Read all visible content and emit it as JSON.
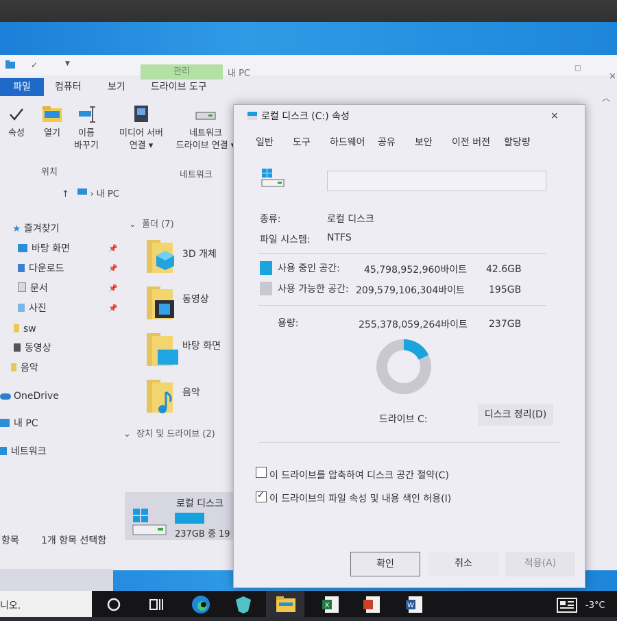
{
  "explorer": {
    "title": "내 PC",
    "ribbon_context": "관리",
    "tabs": [
      "파일",
      "컴퓨터",
      "보기",
      "드라이브 도구"
    ],
    "ribbon_buttons": {
      "properties": "속성",
      "open": "열기",
      "rename_1": "이름",
      "rename_2": "바꾸기",
      "media_1": "미디어 서버",
      "media_2": "연결 ▾",
      "netdrive_1": "네트워크",
      "netdrive_2": "드라이브 연결 ▾"
    },
    "ribbon_groups": {
      "location": "위치",
      "network": "네트워크"
    },
    "address": "내 PC",
    "nav": {
      "quick_access": "즐겨찾기",
      "desktop": "바탕 화면",
      "downloads": "다운로드",
      "documents": "문서",
      "pictures": "사진",
      "sw": "sw",
      "videos": "동영상",
      "music": "음악",
      "onedrive": "OneDrive",
      "this_pc": "내 PC",
      "network": "네트워크"
    },
    "folders_header": "폴더 (7)",
    "folders": [
      "3D 개체",
      "동영상",
      "바탕 화면",
      "음악"
    ],
    "devices_header": "장치 및 드라이브 (2)",
    "drive": {
      "name": "로컬 디스크",
      "size_text": "237GB 중 19",
      "used_fraction": 0.18
    },
    "status": {
      "items": "항목",
      "selected": "1개 항목 선택함"
    }
  },
  "dialog": {
    "title": "로컬 디스크 (C:) 속성",
    "close": "×",
    "tabs": [
      "일반",
      "도구",
      "하드웨어",
      "공유",
      "보안",
      "이전 버전",
      "할당량"
    ],
    "type_label": "종류:",
    "type_value": "로컬 디스크",
    "fs_label": "파일 시스템:",
    "fs_value": "NTFS",
    "used_label": "사용 중인 공간:",
    "used_bytes": "45,798,952,960바이트",
    "used_gb": "42.6GB",
    "free_label": "사용 가능한 공간:",
    "free_bytes": "209,579,106,304바이트",
    "free_gb": "195GB",
    "capacity_label": "용량:",
    "capacity_bytes": "255,378,059,264바이트",
    "capacity_gb": "237GB",
    "drive_label": "드라이브 C:",
    "cleanup_button": "디스크 정리(D)",
    "compress_checkbox": "이 드라이브를 압축하여 디스크 공간 절약(C)",
    "compress_checked": false,
    "index_checkbox": "이 드라이브의 파일 속성 및 내용 색인 허용(I)",
    "index_checked": true,
    "ok": "확인",
    "cancel": "취소",
    "apply": "적용(A)",
    "used_fraction": 0.179,
    "colors": {
      "used": "#1aa3dc",
      "free": "#c8c8d0"
    }
  },
  "taskbar": {
    "search_text": "니오.",
    "weather": "-3°C"
  }
}
